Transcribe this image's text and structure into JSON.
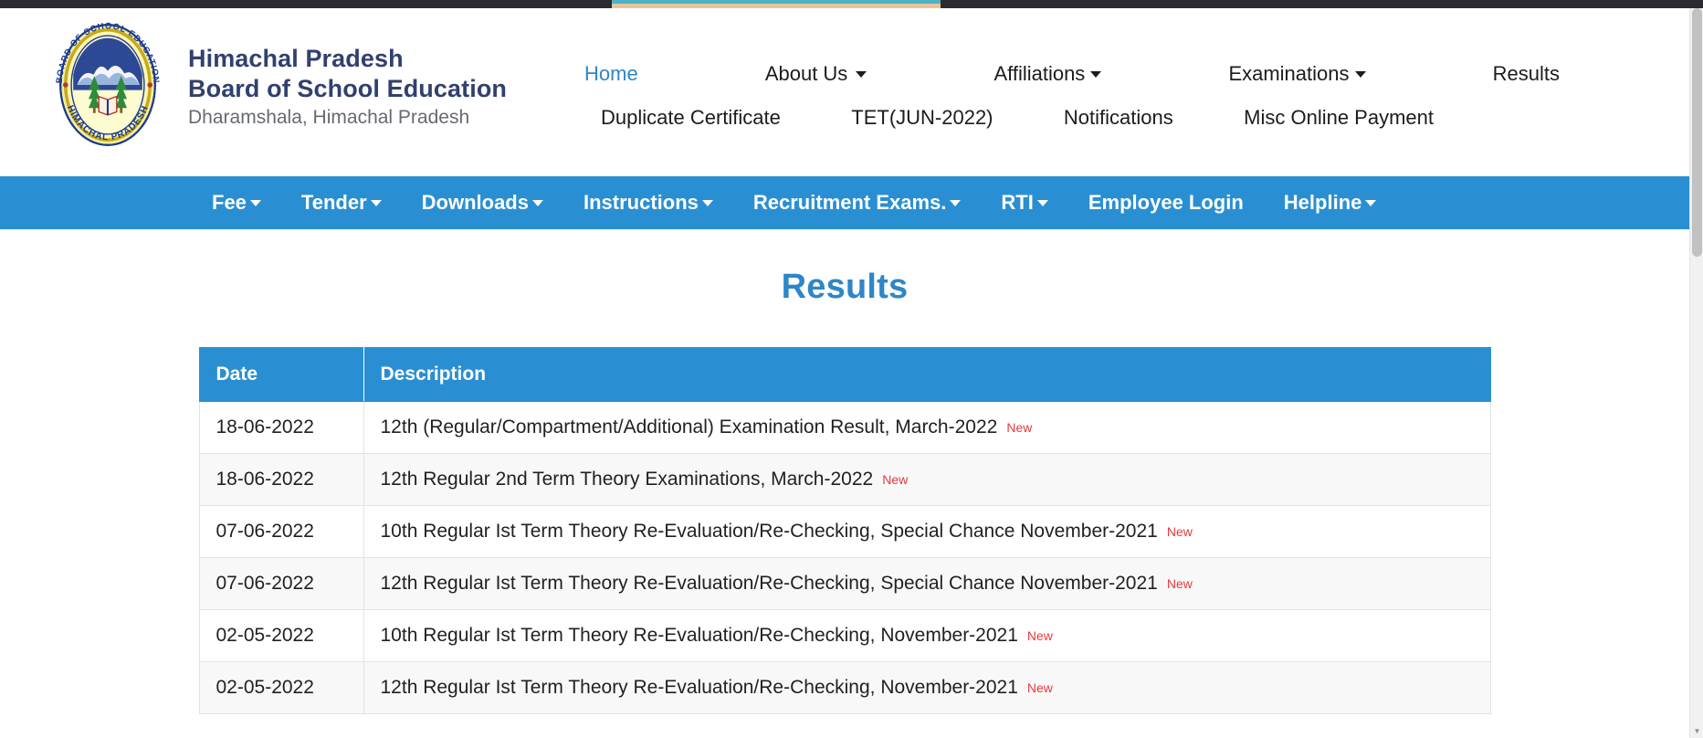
{
  "brand": {
    "logo_icon": "hpbose-seal-logo",
    "logo_ring_top_text": "BOARD OF SCHOOL EDUCATION",
    "logo_ring_bottom_text": "HIMACHAL PRADESH",
    "line1": "Himachal Pradesh",
    "line2": "Board of School Education",
    "line3": "Dharamshala, Himachal Pradesh"
  },
  "topnav": {
    "row1": [
      {
        "label": "Home",
        "caret": false,
        "active": true
      },
      {
        "label": "About Us",
        "caret": true,
        "active": false
      },
      {
        "label": "Affiliations",
        "caret": true,
        "active": false
      },
      {
        "label": "Examinations",
        "caret": true,
        "active": false
      },
      {
        "label": "Results",
        "caret": false,
        "active": false
      }
    ],
    "row2": [
      {
        "label": "Duplicate Certificate",
        "caret": false,
        "active": false
      },
      {
        "label": "TET(JUN-2022)",
        "caret": false,
        "active": false
      },
      {
        "label": "Notifications",
        "caret": false,
        "active": false
      },
      {
        "label": "Misc Online Payment",
        "caret": false,
        "active": false
      }
    ]
  },
  "bluebar": {
    "background_color": "#2a8fd2",
    "items": [
      {
        "label": "Fee",
        "caret": true
      },
      {
        "label": "Tender",
        "caret": true
      },
      {
        "label": "Downloads",
        "caret": true
      },
      {
        "label": "Instructions",
        "caret": true
      },
      {
        "label": "Recruitment Exams.",
        "caret": true
      },
      {
        "label": "RTI",
        "caret": true
      },
      {
        "label": "Employee Login",
        "caret": false
      },
      {
        "label": "Helpline",
        "caret": true
      }
    ]
  },
  "main": {
    "page_title": "Results",
    "title_color": "#2e86c8",
    "table": {
      "headers": [
        "Date",
        "Description"
      ],
      "badge_label": "New",
      "badge_color": "#e8393b",
      "rows": [
        {
          "date": "18-06-2022",
          "description": "12th (Regular/Compartment/Additional) Examination Result, March-2022",
          "new": true
        },
        {
          "date": "18-06-2022",
          "description": "12th Regular 2nd Term Theory Examinations, March-2022",
          "new": true
        },
        {
          "date": "07-06-2022",
          "description": "10th Regular Ist Term Theory Re-Evaluation/Re-Checking, Special Chance November-2021",
          "new": true
        },
        {
          "date": "07-06-2022",
          "description": "12th Regular Ist Term Theory Re-Evaluation/Re-Checking, Special Chance November-2021",
          "new": true
        },
        {
          "date": "02-05-2022",
          "description": "10th Regular Ist Term Theory Re-Evaluation/Re-Checking, November-2021",
          "new": true
        },
        {
          "date": "02-05-2022",
          "description": "12th Regular Ist Term Theory Re-Evaluation/Re-Checking, November-2021",
          "new": true
        }
      ]
    }
  },
  "scrollbar": {
    "up_arrow": "▲",
    "down_arrow": "▼"
  }
}
